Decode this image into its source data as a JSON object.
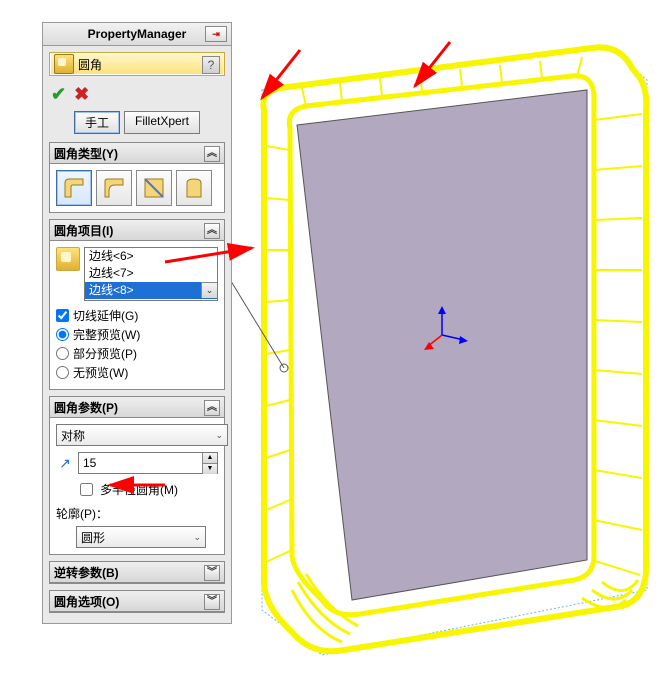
{
  "pm_title": "PropertyManager",
  "feature_name": "圆角",
  "help_char": "?",
  "modes": {
    "manual": "手工",
    "xpert": "FilletXpert"
  },
  "sections": {
    "type": {
      "title": "圆角类型(Y)"
    },
    "items": {
      "title": "圆角项目(I)",
      "edges": [
        "边线<6>",
        "边线<7>",
        "边线<8>"
      ],
      "tangent": "切线延伸(G)",
      "full_preview": "完整预览(W)",
      "partial_preview": "部分预览(P)",
      "no_preview": "无预览(W)"
    },
    "params": {
      "title": "圆角参数(P)",
      "symmetry": "对称",
      "radius_value": "15",
      "multi_radius": "多半径圆角(M)",
      "profile_label": "轮廓(P)：",
      "profile_value": "圆形"
    },
    "reverse": {
      "title": "逆转参数(B)"
    },
    "options": {
      "title": "圆角选项(O)"
    }
  }
}
